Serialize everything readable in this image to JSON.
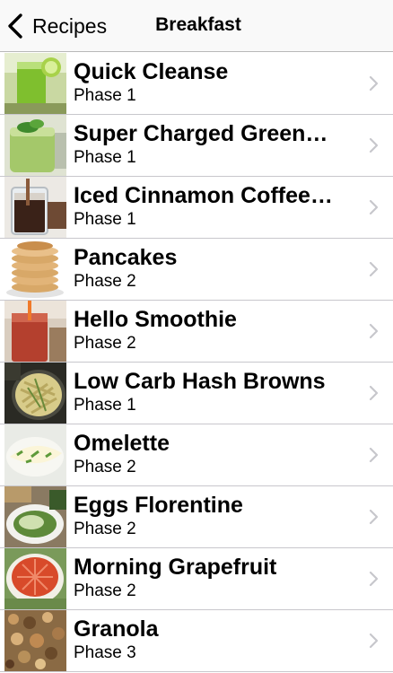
{
  "nav": {
    "back_label": "Recipes",
    "title": "Breakfast"
  },
  "recipes": [
    {
      "title": "Quick Cleanse",
      "phase": "Phase 1",
      "image": "green-juice-photo"
    },
    {
      "title": "Super Charged Green…",
      "phase": "Phase 1",
      "image": "green-smoothie-photo"
    },
    {
      "title": "Iced Cinnamon Coffee…",
      "phase": "Phase 1",
      "image": "iced-coffee-photo"
    },
    {
      "title": "Pancakes",
      "phase": "Phase 2",
      "image": "pancakes-photo"
    },
    {
      "title": "Hello Smoothie",
      "phase": "Phase 2",
      "image": "berry-smoothie-photo"
    },
    {
      "title": "Low Carb Hash Browns",
      "phase": "Phase 1",
      "image": "hash-browns-photo"
    },
    {
      "title": "Omelette",
      "phase": "Phase 2",
      "image": "omelette-photo"
    },
    {
      "title": "Eggs Florentine",
      "phase": "Phase 2",
      "image": "eggs-florentine-photo"
    },
    {
      "title": "Morning Grapefruit",
      "phase": "Phase 2",
      "image": "grapefruit-photo"
    },
    {
      "title": "Granola",
      "phase": "Phase 3",
      "image": "granola-photo"
    }
  ],
  "colors": {
    "navbar_bg": "#f9f9f9",
    "separator": "#c8c7cc",
    "chevron": "#c7c7cc"
  }
}
